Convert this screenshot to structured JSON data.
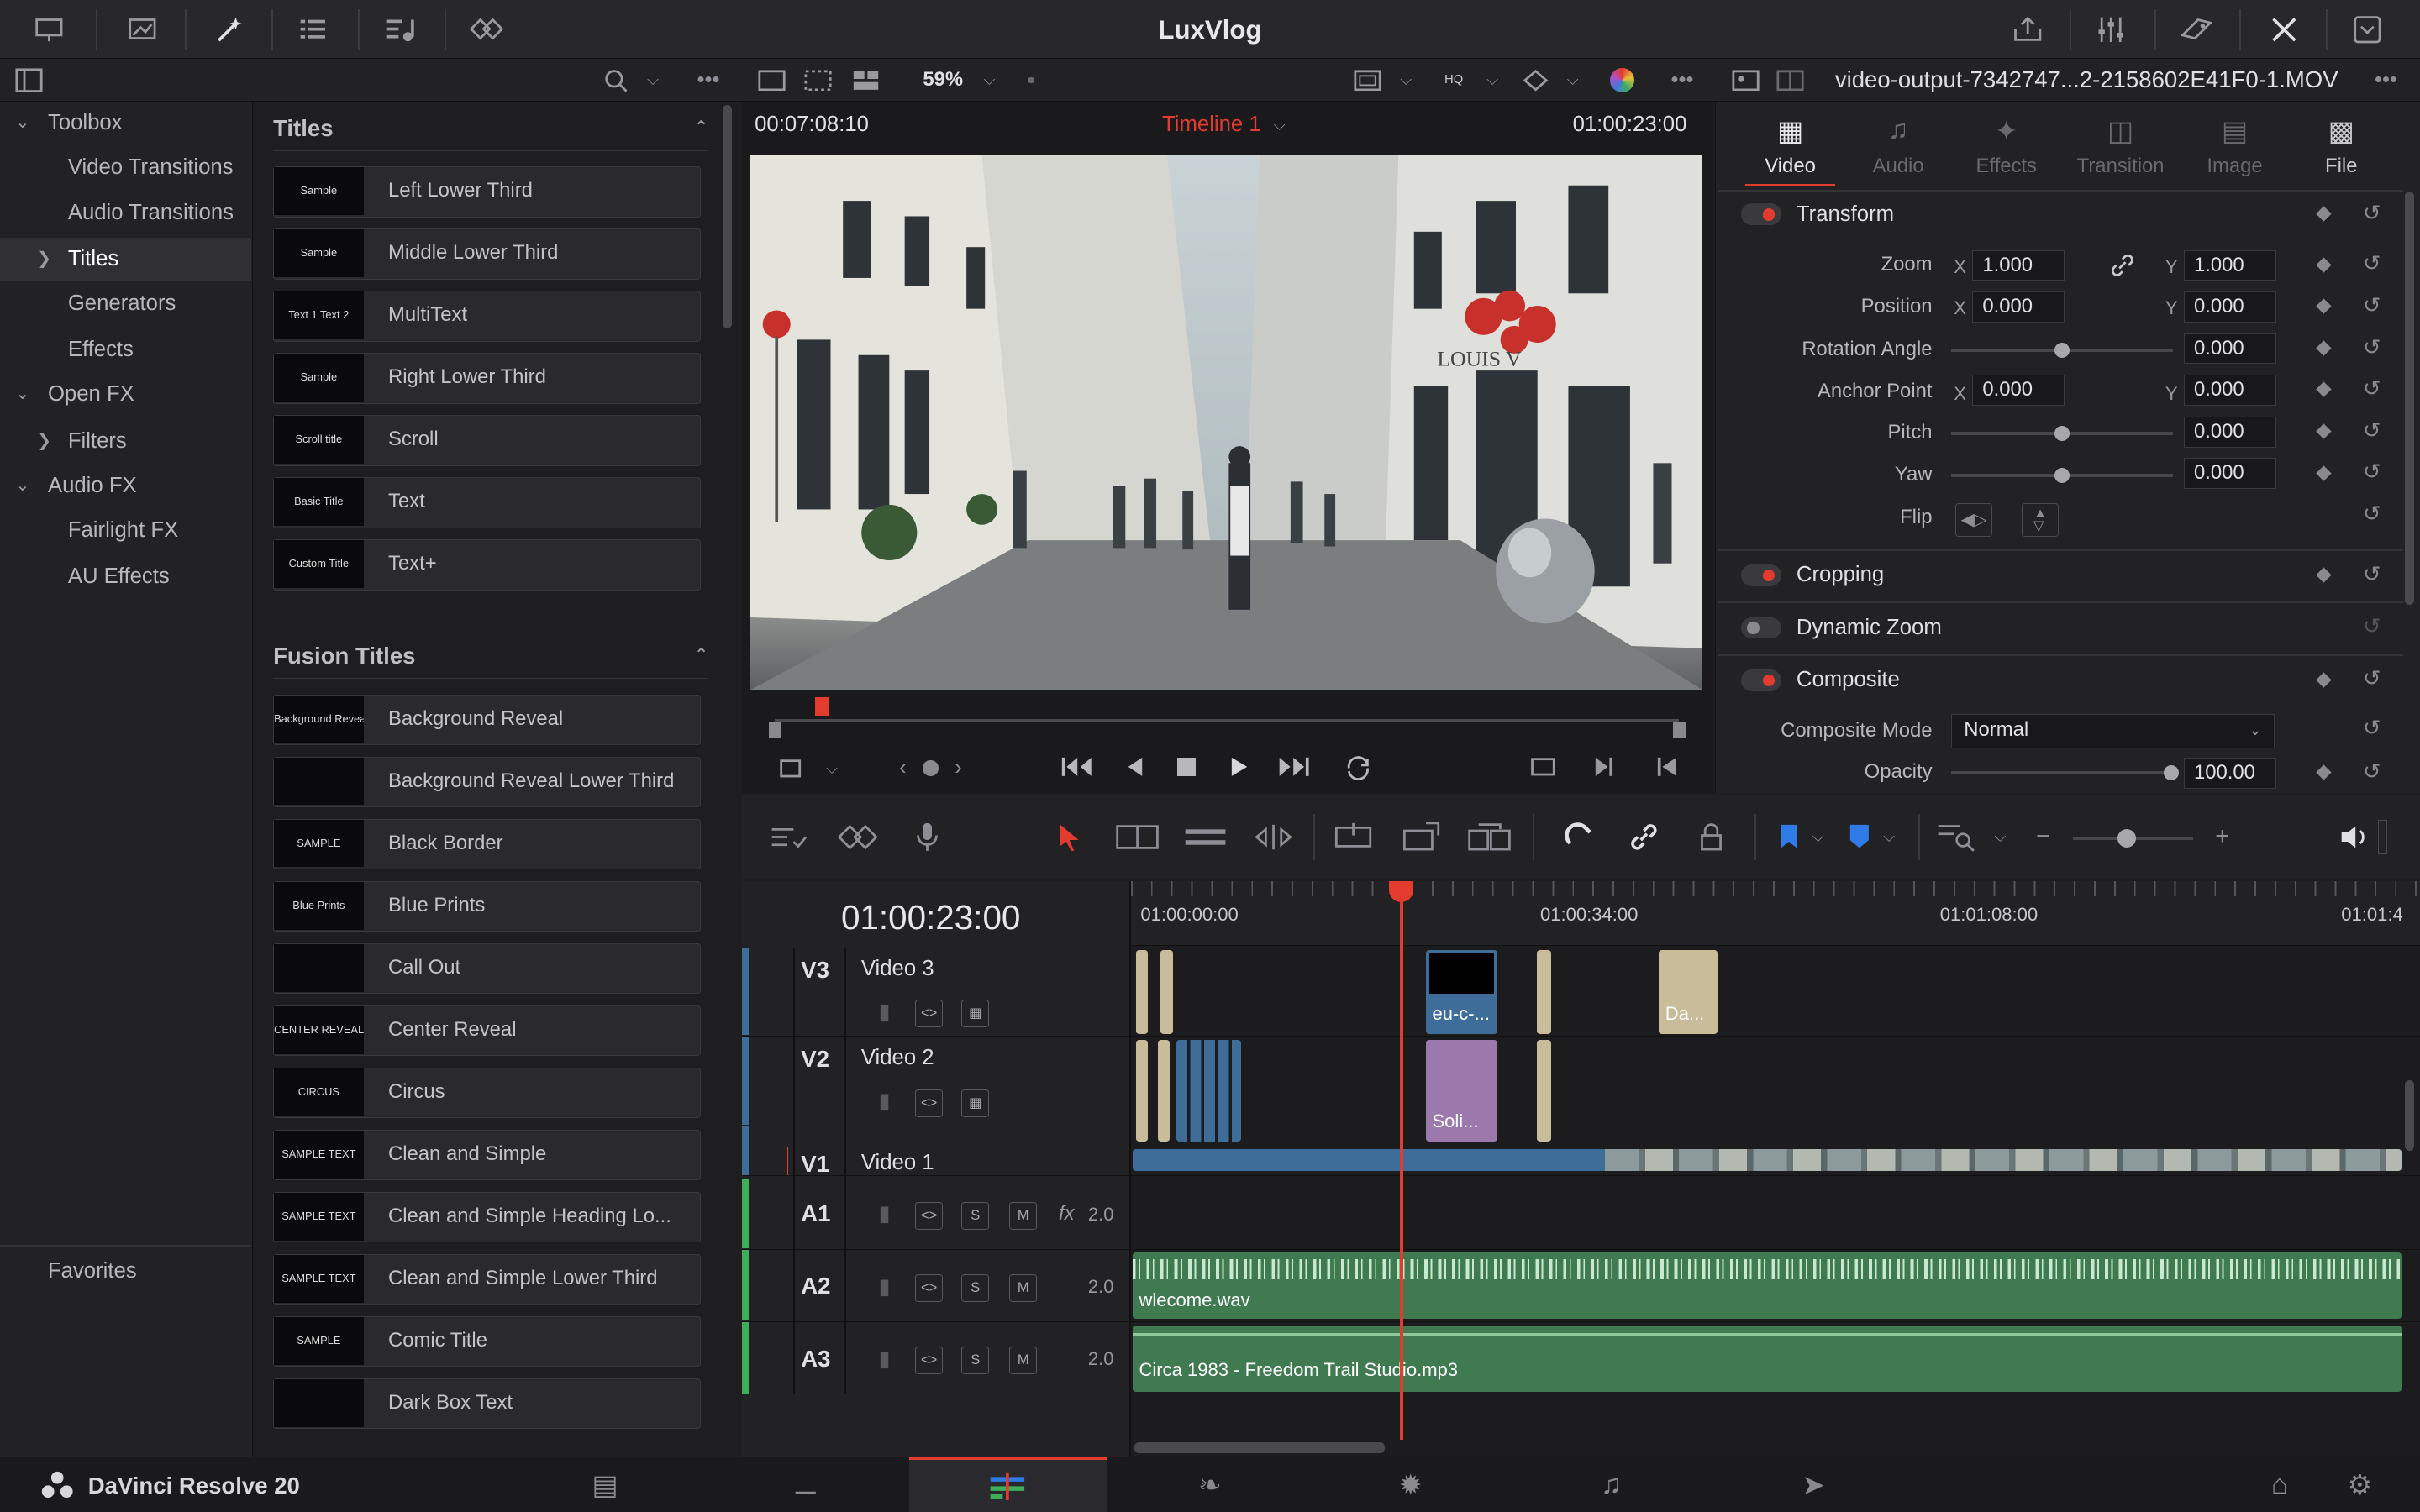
{
  "app": {
    "project_title": "LuxVlog",
    "product_name": "DaVinci Resolve 20"
  },
  "toolbox": {
    "items": [
      {
        "label": "Toolbox",
        "level": 0,
        "expanded": true
      },
      {
        "label": "Video Transitions",
        "level": 1
      },
      {
        "label": "Audio Transitions",
        "level": 1
      },
      {
        "label": "Titles",
        "level": 1,
        "selected": true
      },
      {
        "label": "Generators",
        "level": 1
      },
      {
        "label": "Effects",
        "level": 1
      },
      {
        "label": "Open FX",
        "level": 0,
        "expanded": true
      },
      {
        "label": "Filters",
        "level": 1,
        "collapsed": true
      },
      {
        "label": "Audio FX",
        "level": 0,
        "expanded": true
      },
      {
        "label": "Fairlight FX",
        "level": 1
      },
      {
        "label": "AU Effects",
        "level": 1
      }
    ],
    "favorites_label": "Favorites"
  },
  "titles": {
    "section_label": "Titles",
    "items": [
      {
        "label": "Left Lower Third",
        "thumb": "Sample"
      },
      {
        "label": "Middle Lower Third",
        "thumb": "Sample"
      },
      {
        "label": "MultiText",
        "thumb": "Text 1 Text 2"
      },
      {
        "label": "Right Lower Third",
        "thumb": "Sample"
      },
      {
        "label": "Scroll",
        "thumb": "Scroll title"
      },
      {
        "label": "Text",
        "thumb": "Basic Title"
      },
      {
        "label": "Text+",
        "thumb": "Custom Title"
      }
    ]
  },
  "fusion_titles": {
    "section_label": "Fusion Titles",
    "items": [
      {
        "label": "Background Reveal",
        "thumb": "Background Reveal"
      },
      {
        "label": "Background Reveal Lower Third",
        "thumb": ""
      },
      {
        "label": "Black Border",
        "thumb": "SAMPLE"
      },
      {
        "label": "Blue Prints",
        "thumb": "Blue Prints"
      },
      {
        "label": "Call Out",
        "thumb": ""
      },
      {
        "label": "Center Reveal",
        "thumb": "CENTER REVEAL"
      },
      {
        "label": "Circus",
        "thumb": "CIRCUS"
      },
      {
        "label": "Clean and Simple",
        "thumb": "SAMPLE TEXT"
      },
      {
        "label": "Clean and Simple Heading Lo...",
        "thumb": "SAMPLE TEXT"
      },
      {
        "label": "Clean and Simple Lower Third",
        "thumb": "SAMPLE TEXT"
      },
      {
        "label": "Comic Title",
        "thumb": "SAMPLE"
      },
      {
        "label": "Dark Box Text",
        "thumb": ""
      }
    ]
  },
  "viewer": {
    "zoom": "59%",
    "left_timecode": "00:07:08:10",
    "timeline_name": "Timeline 1",
    "right_timecode": "01:00:23:00"
  },
  "inspector": {
    "clip_name": "video-output-7342747...2-2158602E41F0-1.MOV",
    "tabs": [
      "Video",
      "Audio",
      "Effects",
      "Transition",
      "Image",
      "File"
    ],
    "active_tab": "Video",
    "transform": {
      "title": "Transform",
      "zoom_label": "Zoom",
      "zoom_x": "1.000",
      "zoom_y": "1.000",
      "position_label": "Position",
      "position_x": "0.000",
      "position_y": "0.000",
      "rotation_label": "Rotation Angle",
      "rotation": "0.000",
      "anchor_label": "Anchor Point",
      "anchor_x": "0.000",
      "anchor_y": "0.000",
      "pitch_label": "Pitch",
      "pitch": "0.000",
      "yaw_label": "Yaw",
      "yaw": "0.000",
      "flip_label": "Flip",
      "x_label": "X",
      "y_label": "Y"
    },
    "cropping": {
      "title": "Cropping"
    },
    "dynamic_zoom": {
      "title": "Dynamic Zoom"
    },
    "composite": {
      "title": "Composite",
      "mode_label": "Composite Mode",
      "mode_value": "Normal",
      "opacity_label": "Opacity",
      "opacity": "100.00"
    }
  },
  "timeline": {
    "current_timecode": "01:00:23:00",
    "ruler": [
      "01:00:00:00",
      "01:00:34:00",
      "01:01:08:00",
      "01:01:4"
    ],
    "tracks": [
      {
        "id": "V3",
        "name": "Video 3"
      },
      {
        "id": "V2",
        "name": "Video 2"
      },
      {
        "id": "V1",
        "name": "Video 1"
      },
      {
        "id": "A1",
        "name": "",
        "fx": "fx",
        "channels": "2.0"
      },
      {
        "id": "A2",
        "name": "",
        "channels": "2.0"
      },
      {
        "id": "A3",
        "name": "",
        "channels": "2.0"
      }
    ],
    "clips": {
      "v3_clip_a": "eu-c-...",
      "v3_clip_b": "Da...",
      "v2_clip": "Soli...",
      "a2_clip": "wlecome.wav",
      "a3_clip": "Circa 1983 - Freedom Trail Studio.mp3"
    },
    "solo_label": "S",
    "mute_label": "M"
  },
  "colors": {
    "accent_red": "#e43b2f",
    "audio_green": "#3f7a50",
    "video_blue": "#3f6d99",
    "title_clip_beige": "#c8bc9a",
    "solid_purple": "#9b79ad"
  }
}
